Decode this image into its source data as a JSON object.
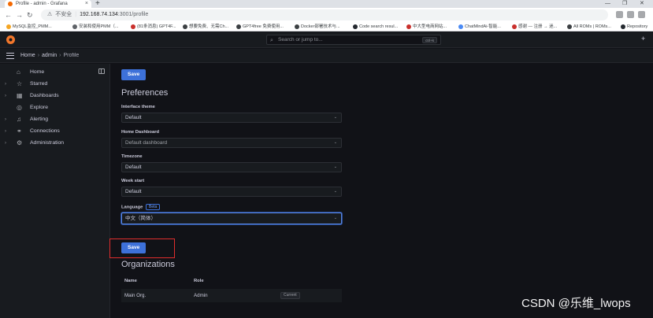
{
  "browser": {
    "tab_title": "Profile - admin - Grafana",
    "tab_close": "×",
    "new_tab": "+",
    "window_min": "—",
    "window_max": "❐",
    "window_close": "✕",
    "insecure_label": "不安全",
    "url_host": "192.168.74.134",
    "url_path": ":3001/profile",
    "bookmarks": [
      {
        "label": "MySQL监控_PMM...",
        "color": "#f5a623"
      },
      {
        "label": "安装和使用PMM（...",
        "color": "#5f6368"
      },
      {
        "label": "(81条消息) GPT4F...",
        "color": "#c9302c"
      },
      {
        "label": "想要免费、无需Ch...",
        "color": "#3c4043"
      },
      {
        "label": "GPT4free 免费使用...",
        "color": "#3c4043"
      },
      {
        "label": "Docker部署技术与...",
        "color": "#3c4043"
      },
      {
        "label": "Code search resul...",
        "color": "#24292f"
      },
      {
        "label": "中大型电商网站...",
        "color": "#c9302c"
      },
      {
        "label": "ChatMindAi-智能...",
        "color": "#4a8af4"
      },
      {
        "label": "感谢 — 注册 → 迷...",
        "color": "#c9302c"
      },
      {
        "label": "All ROMs | ROMs...",
        "color": "#3c4043"
      },
      {
        "label": "Repository",
        "color": "#24292f"
      }
    ]
  },
  "topbar": {
    "search_placeholder": "Search or jump to...",
    "search_shortcut": "ctrl+k",
    "add_label": "+"
  },
  "breadcrumb": {
    "home": "Home",
    "admin": "admin",
    "profile": "Profile",
    "separator": "›"
  },
  "sidebar": {
    "items": [
      {
        "label": "Home",
        "icon": "home-icon",
        "glyph": "⌂",
        "expandable": false
      },
      {
        "label": "Starred",
        "icon": "star-icon",
        "glyph": "☆",
        "expandable": true
      },
      {
        "label": "Dashboards",
        "icon": "apps-icon",
        "glyph": "▦",
        "expandable": true
      },
      {
        "label": "Explore",
        "icon": "compass-icon",
        "glyph": "◎",
        "expandable": false
      },
      {
        "label": "Alerting",
        "icon": "bell-icon",
        "glyph": "♫",
        "expandable": true
      },
      {
        "label": "Connections",
        "icon": "link-icon",
        "glyph": "⚭",
        "expandable": true
      },
      {
        "label": "Administration",
        "icon": "cog-icon",
        "glyph": "⚙",
        "expandable": true
      }
    ]
  },
  "profile": {
    "top_save_label": "Save",
    "preferences_title": "Preferences",
    "interface_theme_label": "Interface theme",
    "interface_theme_value": "Default",
    "home_dashboard_label": "Home Dashboard",
    "home_dashboard_placeholder": "Default dashboard",
    "timezone_label": "Timezone",
    "timezone_value": "Default",
    "week_start_label": "Week start",
    "week_start_value": "Default",
    "language_label": "Language",
    "language_badge": "Beta",
    "language_value": "中文（简体）",
    "save_label": "Save",
    "organizations_title": "Organizations",
    "org_columns": [
      "Name",
      "Role"
    ],
    "orgs": [
      {
        "name": "Main Org.",
        "role": "Admin",
        "badge": "Current"
      }
    ]
  },
  "watermark": "CSDN @乐维_lwops",
  "colors": {
    "background": "#111217",
    "panel": "#181b1f",
    "primary": "#3d71d9",
    "highlight": "#e02d2d",
    "grafana_orange": "#f2772b"
  }
}
